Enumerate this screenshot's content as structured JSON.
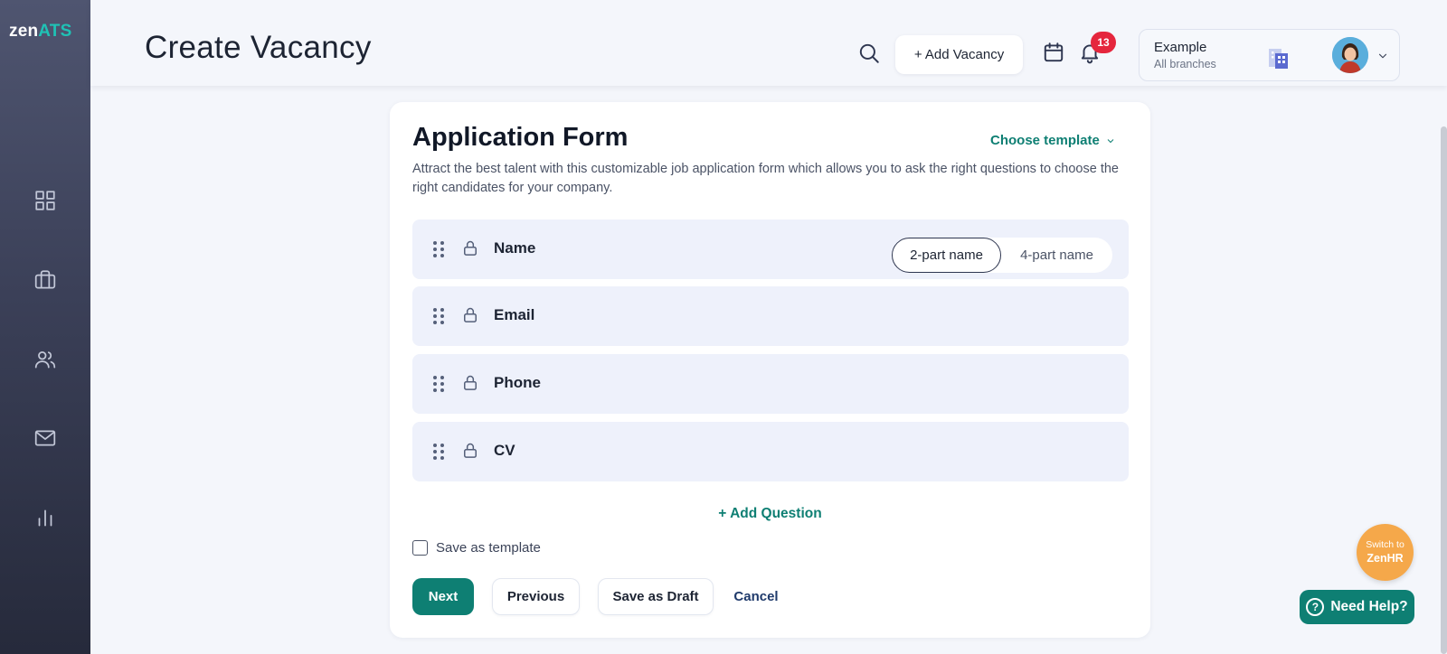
{
  "sidebar": {
    "logo_zen": "zen",
    "logo_ats": "ATS",
    "nav_icons": [
      "grid-icon",
      "briefcase-icon",
      "users-icon",
      "mail-icon",
      "bar-chart-icon"
    ]
  },
  "header": {
    "title": "Create Vacancy",
    "add_vacancy_label": "+ Add Vacancy",
    "notification_count": "13",
    "company_name": "Example",
    "company_scope": "All branches"
  },
  "form": {
    "title": "Application Form",
    "choose_template_label": "Choose template",
    "description": "Attract the best talent with this customizable job application form which allows you to ask the right questions to choose the right candidates for your company.",
    "fields": [
      {
        "label": "Name",
        "locked": true
      },
      {
        "label": "Email",
        "locked": true
      },
      {
        "label": "Phone",
        "locked": true
      },
      {
        "label": "CV",
        "locked": true
      }
    ],
    "name_format_options": [
      "2-part name",
      "4-part name"
    ],
    "name_format_selected": "2-part name",
    "add_question_label": "+ Add Question",
    "save_as_template_label": "Save as template",
    "save_as_template_checked": false
  },
  "actions": {
    "next_label": "Next",
    "previous_label": "Previous",
    "save_draft_label": "Save as Draft",
    "cancel_label": "Cancel"
  },
  "widgets": {
    "switch_line1": "Switch to",
    "switch_line2": "ZenHR",
    "help_label": "Need Help?",
    "help_icon_glyph": "?"
  },
  "colors": {
    "brand_teal": "#0e7f73",
    "logo_accent": "#1fc2b5",
    "badge_red": "#e5263d",
    "switch_orange": "#f5a84a"
  }
}
